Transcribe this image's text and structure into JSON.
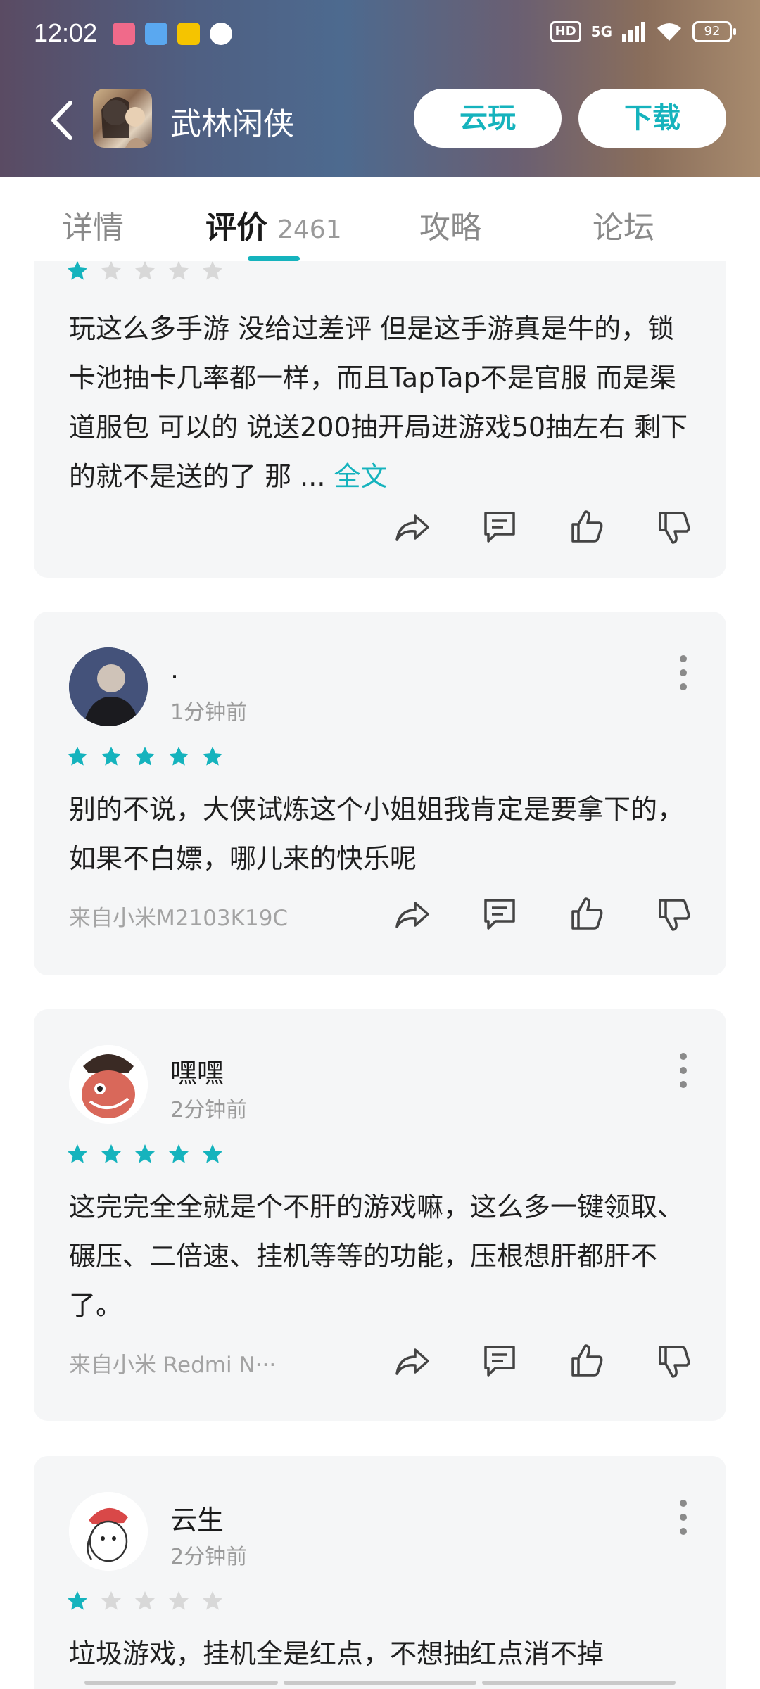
{
  "status_bar": {
    "time": "12:02",
    "network": "5G",
    "hd_label": "HD",
    "battery": "92",
    "notification_icons": [
      "lolita-app-icon",
      "browser-app-icon",
      "meituan-app-icon",
      "message-icon"
    ]
  },
  "header": {
    "title": "武林闲侠",
    "cloud_play_label": "云玩",
    "download_label": "下载"
  },
  "tabs": [
    {
      "label": "详情"
    },
    {
      "label": "评价",
      "count": "2461",
      "active": true
    },
    {
      "label": "攻略"
    },
    {
      "label": "论坛"
    }
  ],
  "reviews": [
    {
      "rating": 1,
      "text": "玩这么多手游 没给过差评 但是这手游真是牛的，锁卡池抽卡几率都一样，而且TapTap不是官服 而是渠道服包 可以的 说送200抽开局进游戏50抽左右 剩下的就不是送的了 那 ...",
      "full_link": "全文"
    },
    {
      "user": ".",
      "time": "1分钟前",
      "rating": 5,
      "text": "别的不说，大侠试炼这个小姐姐我肯定是要拿下的，如果不白嫖，哪儿来的快乐呢",
      "device": "来自小米M2103K19C"
    },
    {
      "user": "嘿嘿",
      "time": "2分钟前",
      "rating": 5,
      "text": "这完完全全就是个不肝的游戏嘛，这么多一键领取、碾压、二倍速、挂机等等的功能，压根想肝都肝不了。",
      "device": "来自小米 Redmi N···"
    },
    {
      "user": "云生",
      "time": "2分钟前",
      "rating": 1,
      "text": "垃圾游戏，挂机全是红点，不想抽红点消不掉"
    }
  ],
  "colors": {
    "accent": "#15b3bd",
    "star_empty": "#d8d8d8",
    "card_bg": "#f5f6f7"
  }
}
